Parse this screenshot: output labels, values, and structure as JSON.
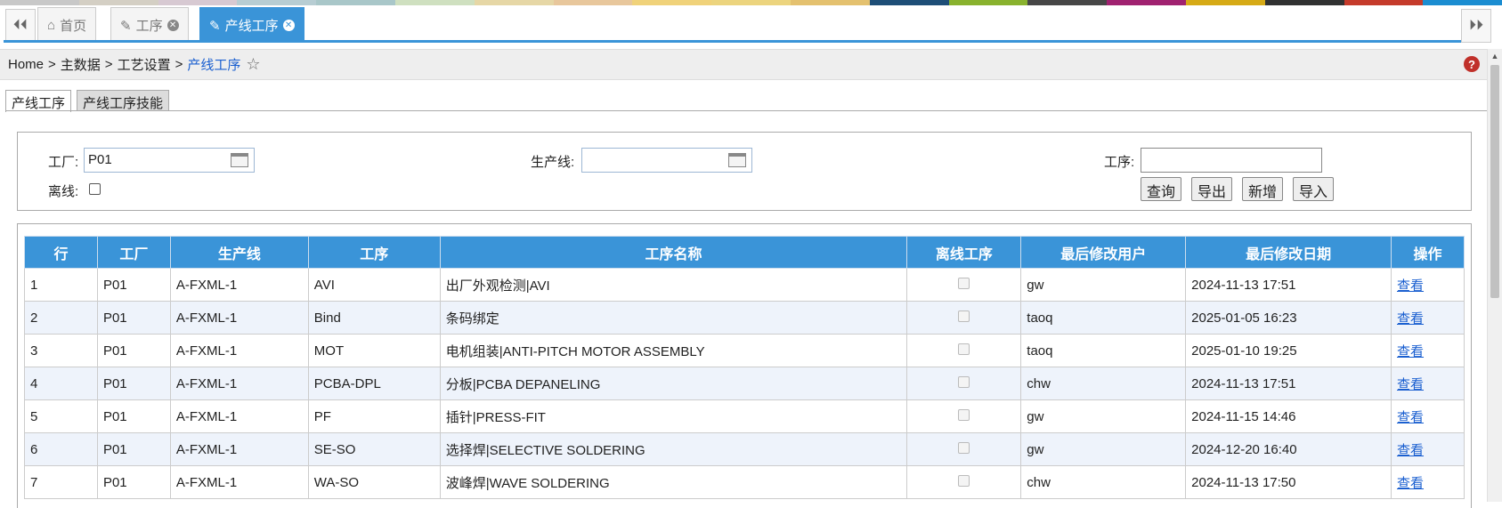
{
  "colors": {
    "strip": [
      "#c8c8c8",
      "#d4cfc4",
      "#d7c9d2",
      "#b7cdd3",
      "#a9c7c9",
      "#cfe0c0",
      "#e6d7a6",
      "#e8c79c",
      "#f0d27a",
      "#ecd47e",
      "#e4c16f",
      "#1e4e77",
      "#89b22e",
      "#474747",
      "#a02270",
      "#d6aa16",
      "#313232",
      "#c53b2b",
      "#1b8dd1"
    ],
    "accent": "#3a94d8",
    "link": "#1a5fd0"
  },
  "tabs": [
    {
      "label": "首页",
      "icon": "home-icon"
    },
    {
      "label": "工序",
      "icon": "edit-icon"
    },
    {
      "label": "产线工序",
      "icon": "edit-icon",
      "active": true
    }
  ],
  "breadcrumb": {
    "home": "Home",
    "l1": "主数据",
    "l2": "工艺设置",
    "current": "产线工序",
    "sep": ">"
  },
  "subtabs": [
    "产线工序",
    "产线工序技能"
  ],
  "filters": {
    "factory_label": "工厂:",
    "factory_value": "P01",
    "line_label": "生产线:",
    "line_value": "",
    "process_label": "工序:",
    "process_value": "",
    "offline_label": "离线:"
  },
  "buttons": {
    "query": "查询",
    "export": "导出",
    "add": "新增",
    "import": "导入"
  },
  "table": {
    "headers": [
      "行",
      "工厂",
      "生产线",
      "工序",
      "工序名称",
      "离线工序",
      "最后修改用户",
      "最后修改日期",
      "操作"
    ],
    "rows": [
      {
        "n": "1",
        "factory": "P01",
        "line": "A-FXML-1",
        "proc": "AVI",
        "name": "出厂外观检测|AVI",
        "user": "gw",
        "date": "2024-11-13 17:51",
        "op": "查看"
      },
      {
        "n": "2",
        "factory": "P01",
        "line": "A-FXML-1",
        "proc": "Bind",
        "name": "条码绑定",
        "user": "taoq",
        "date": "2025-01-05 16:23",
        "op": "查看"
      },
      {
        "n": "3",
        "factory": "P01",
        "line": "A-FXML-1",
        "proc": "MOT",
        "name": "电机组装|ANTI-PITCH MOTOR ASSEMBLY",
        "user": "taoq",
        "date": "2025-01-10 19:25",
        "op": "查看"
      },
      {
        "n": "4",
        "factory": "P01",
        "line": "A-FXML-1",
        "proc": "PCBA-DPL",
        "name": "分板|PCBA DEPANELING",
        "user": "chw",
        "date": "2024-11-13 17:51",
        "op": "查看"
      },
      {
        "n": "5",
        "factory": "P01",
        "line": "A-FXML-1",
        "proc": "PF",
        "name": "插针|PRESS-FIT",
        "user": "gw",
        "date": "2024-11-15 14:46",
        "op": "查看"
      },
      {
        "n": "6",
        "factory": "P01",
        "line": "A-FXML-1",
        "proc": "SE-SO",
        "name": "选择焊|SELECTIVE SOLDERING",
        "user": "gw",
        "date": "2024-12-20 16:40",
        "op": "查看"
      },
      {
        "n": "7",
        "factory": "P01",
        "line": "A-FXML-1",
        "proc": "WA-SO",
        "name": "波峰焊|WAVE SOLDERING",
        "user": "chw",
        "date": "2024-11-13 17:50",
        "op": "查看"
      }
    ]
  }
}
